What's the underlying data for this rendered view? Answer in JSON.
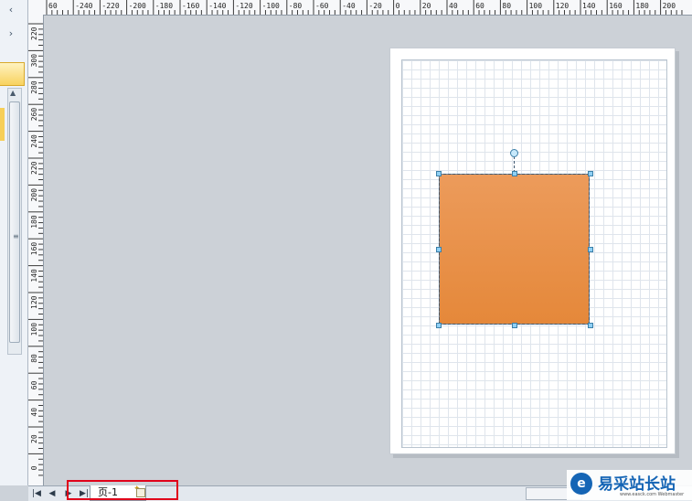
{
  "left_panel": {
    "collapse_glyph": "‹",
    "expand_glyph": "›",
    "scroll_up_glyph": "▲",
    "grip_glyph": "≡"
  },
  "rulers": {
    "top_ticks": [
      "60",
      "-240",
      "-220",
      "-200",
      "-180",
      "-160",
      "-140",
      "-120",
      "-100",
      "-80",
      "-60",
      "-40",
      "-20",
      "0",
      "20",
      "40",
      "60",
      "80",
      "100",
      "120",
      "140",
      "160",
      "180",
      "200"
    ],
    "left_ticks": [
      "220",
      "300",
      "280",
      "260",
      "240",
      "220",
      "200",
      "180",
      "160",
      "140",
      "120",
      "100",
      "80",
      "60",
      "40",
      "20",
      "0"
    ]
  },
  "page_tabs": {
    "nav_first": "|◀",
    "nav_prev": "◀",
    "nav_next": "▶",
    "nav_last": "▶|",
    "active_tab_label": "页-1",
    "insert_icon_glyph": "✦",
    "hscroll_left": "◀"
  },
  "shape": {
    "fill_top": "#ec9b5b",
    "fill_bottom": "#e5883a",
    "selected": true
  },
  "highlight": {
    "color": "#e0001a"
  },
  "watermark": {
    "logo_glyph": "e",
    "title": "易采站长站",
    "subtitle": "www.easck.com Webmaster"
  }
}
